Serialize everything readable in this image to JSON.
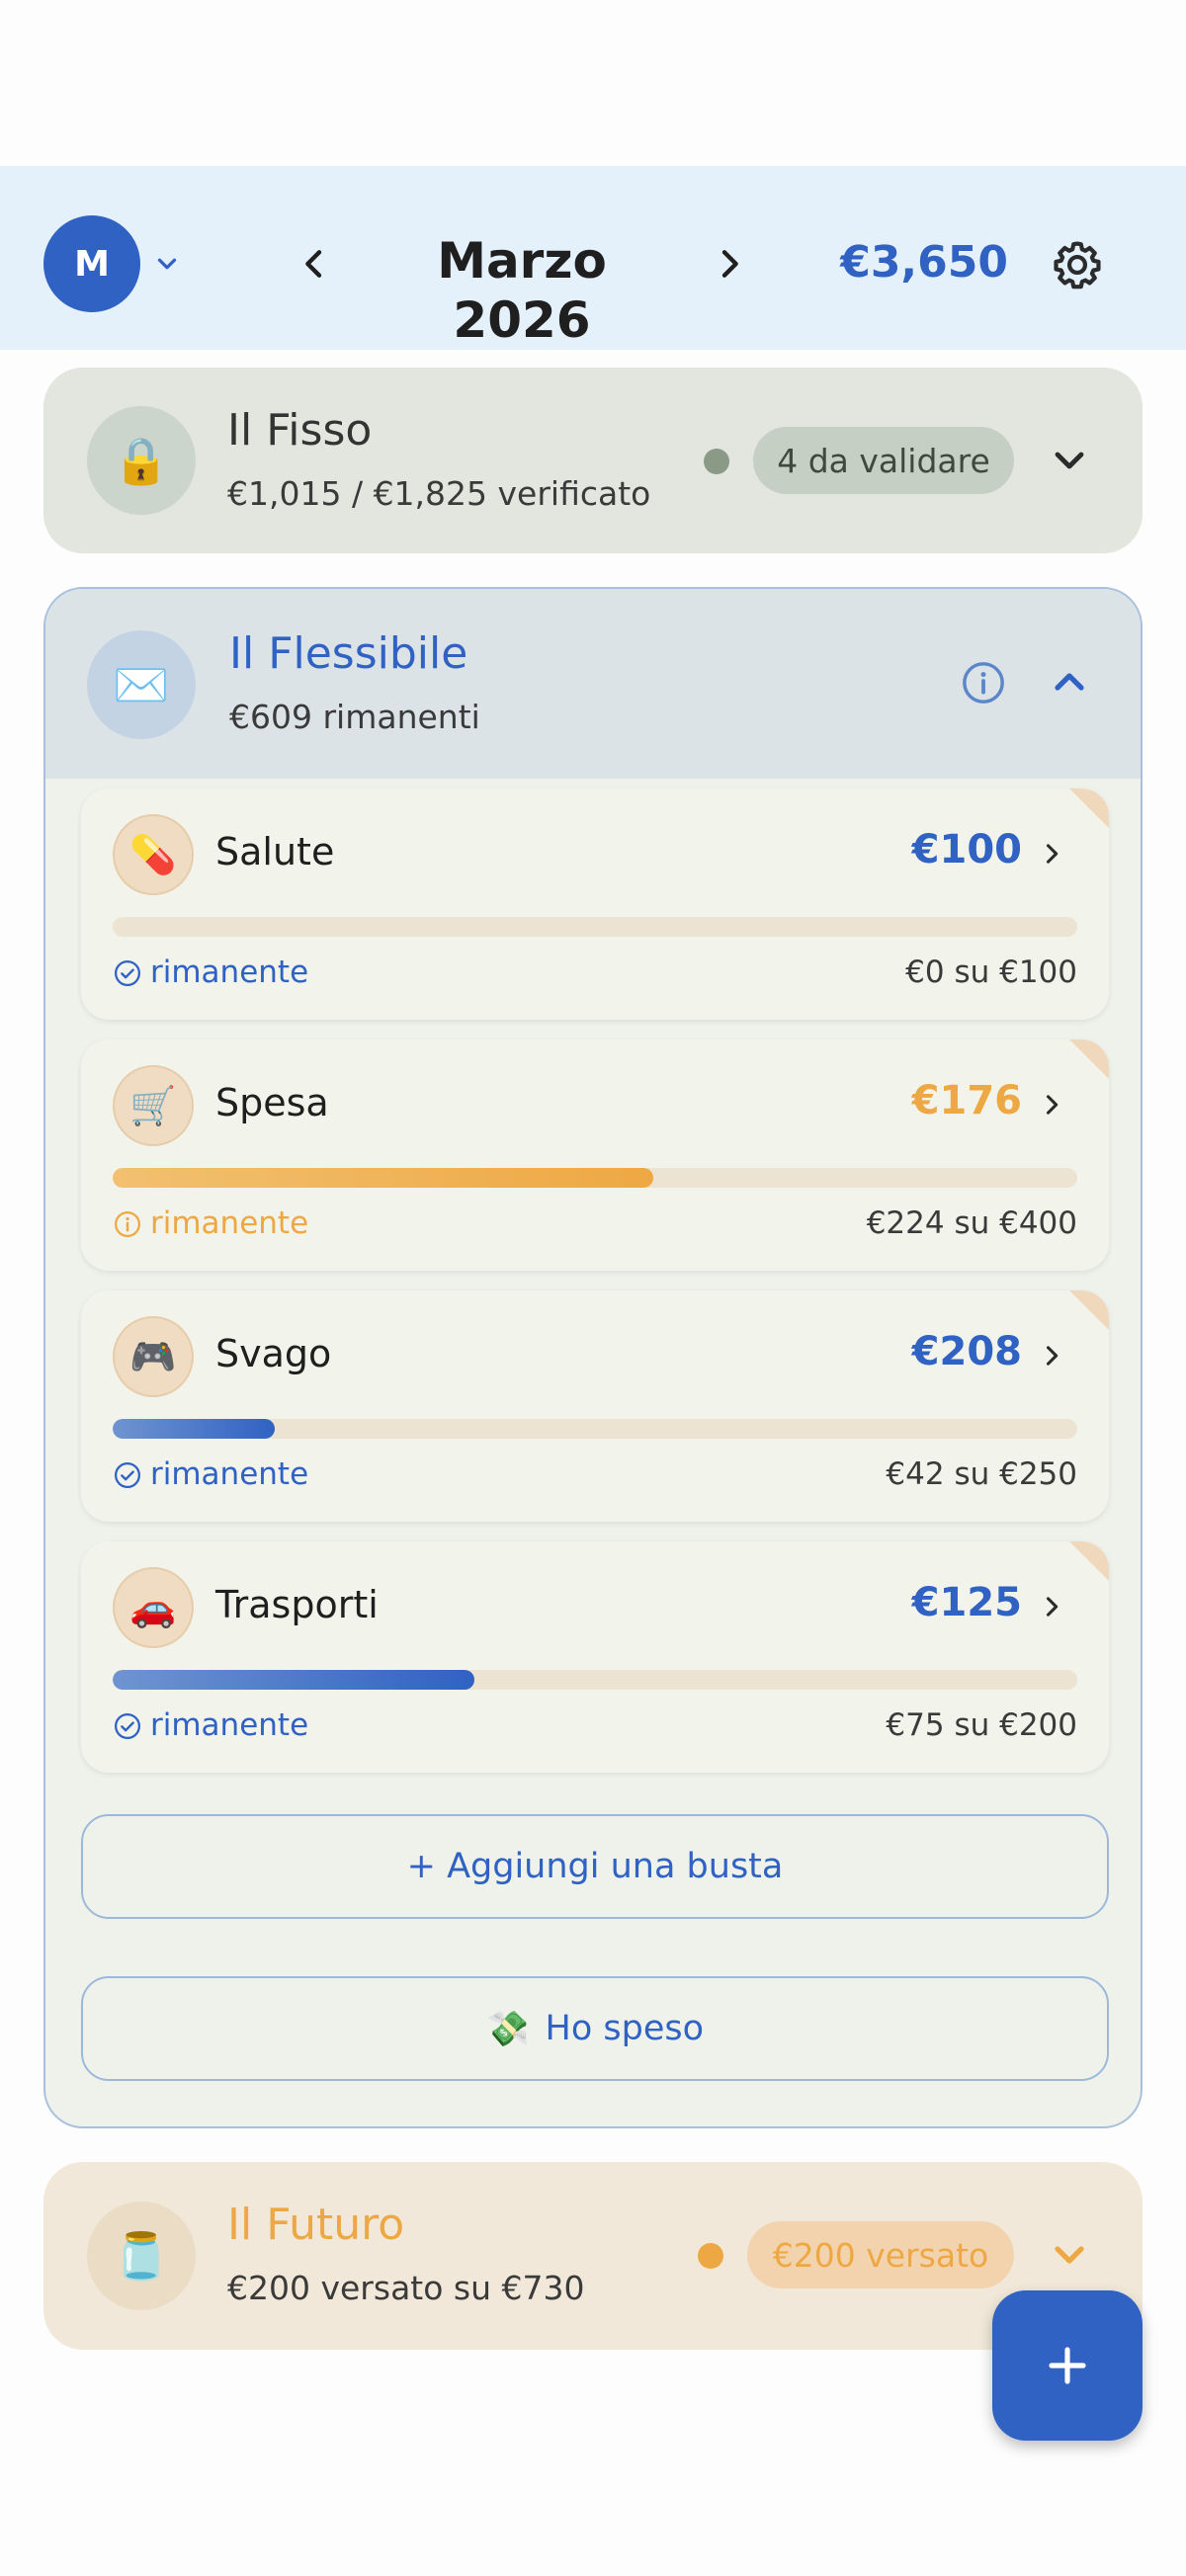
{
  "header": {
    "avatar_initial": "M",
    "month_title": "Marzo 2026",
    "total_amount": "€3,650"
  },
  "fisso": {
    "icon": "🔒",
    "title": "Il Fisso",
    "subtitle": "€1,015 / €1,825 verificato",
    "badge": "4 da validare"
  },
  "flessibile": {
    "icon": "✉️",
    "title": "Il Flessibile",
    "subtitle": "€609 rimanenti",
    "envelopes": [
      {
        "icon": "💊",
        "name": "Salute",
        "amount": "€100",
        "status": "rimanente",
        "usage": "€0 su €100",
        "progress": 0.0,
        "tone": "ok"
      },
      {
        "icon": "🛒",
        "name": "Spesa",
        "amount": "€176",
        "status": "rimanente",
        "usage": "€224 su €400",
        "progress": 0.56,
        "tone": "warn"
      },
      {
        "icon": "🎮",
        "name": "Svago",
        "amount": "€208",
        "status": "rimanente",
        "usage": "€42 su €250",
        "progress": 0.168,
        "tone": "ok"
      },
      {
        "icon": "🚗",
        "name": "Trasporti",
        "amount": "€125",
        "status": "rimanente",
        "usage": "€75 su €200",
        "progress": 0.375,
        "tone": "ok"
      }
    ],
    "add_envelope_label": "+ Aggiungi una busta",
    "spent_icon": "💸",
    "spent_label": "Ho speso"
  },
  "futuro": {
    "icon": "🫙",
    "title": "Il Futuro",
    "subtitle": "€200 versato su €730",
    "badge": "€200 versato"
  },
  "colors": {
    "accent_blue": "#2f62c3",
    "warn_orange": "#eea843",
    "fisso_dot": "#8a9a86",
    "futuro_dot": "#eea843"
  },
  "icons": {
    "avatar_menu": "chevron-down-icon",
    "prev": "chevron-left-icon",
    "next": "chevron-right-icon",
    "settings": "gear-icon",
    "fab": "plus-icon"
  }
}
